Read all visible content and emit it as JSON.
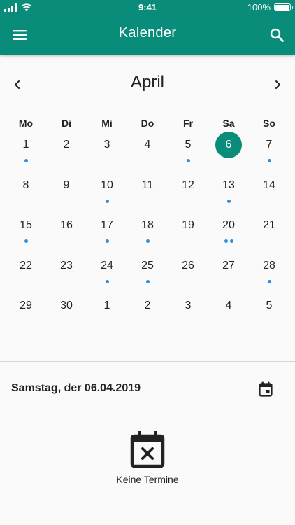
{
  "status_bar": {
    "time": "9:41",
    "battery_text": "100%",
    "battery_level": 1.0,
    "signal_icon": "signal-icon",
    "wifi_icon": "wifi-icon"
  },
  "app_bar": {
    "title": "Kalender",
    "menu_icon": "menu-icon",
    "search_icon": "search-icon",
    "background": "#0a8c7a"
  },
  "calendar": {
    "month": "April",
    "prev_icon": "chevron-left-icon",
    "next_icon": "chevron-right-icon",
    "weekdays": [
      "Mo",
      "Di",
      "Mi",
      "Do",
      "Fr",
      "Sa",
      "So"
    ],
    "selected_color": "#0a8c7a",
    "event_dot_color": "#2a8fe0",
    "weeks": [
      [
        {
          "day": "1",
          "dots": 1,
          "selected": false
        },
        {
          "day": "2",
          "dots": 0,
          "selected": false
        },
        {
          "day": "3",
          "dots": 0,
          "selected": false
        },
        {
          "day": "4",
          "dots": 0,
          "selected": false
        },
        {
          "day": "5",
          "dots": 1,
          "selected": false
        },
        {
          "day": "6",
          "dots": 0,
          "selected": true
        },
        {
          "day": "7",
          "dots": 1,
          "selected": false
        }
      ],
      [
        {
          "day": "8",
          "dots": 0,
          "selected": false
        },
        {
          "day": "9",
          "dots": 0,
          "selected": false
        },
        {
          "day": "10",
          "dots": 1,
          "selected": false
        },
        {
          "day": "11",
          "dots": 0,
          "selected": false
        },
        {
          "day": "12",
          "dots": 0,
          "selected": false
        },
        {
          "day": "13",
          "dots": 1,
          "selected": false
        },
        {
          "day": "14",
          "dots": 0,
          "selected": false
        }
      ],
      [
        {
          "day": "15",
          "dots": 1,
          "selected": false
        },
        {
          "day": "16",
          "dots": 0,
          "selected": false
        },
        {
          "day": "17",
          "dots": 1,
          "selected": false
        },
        {
          "day": "18",
          "dots": 1,
          "selected": false
        },
        {
          "day": "19",
          "dots": 0,
          "selected": false
        },
        {
          "day": "20",
          "dots": 2,
          "selected": false
        },
        {
          "day": "21",
          "dots": 0,
          "selected": false
        }
      ],
      [
        {
          "day": "22",
          "dots": 0,
          "selected": false
        },
        {
          "day": "23",
          "dots": 0,
          "selected": false
        },
        {
          "day": "24",
          "dots": 1,
          "selected": false
        },
        {
          "day": "25",
          "dots": 1,
          "selected": false
        },
        {
          "day": "26",
          "dots": 0,
          "selected": false
        },
        {
          "day": "27",
          "dots": 0,
          "selected": false
        },
        {
          "day": "28",
          "dots": 1,
          "selected": false
        }
      ],
      [
        {
          "day": "29",
          "dots": 0,
          "selected": false
        },
        {
          "day": "30",
          "dots": 0,
          "selected": false
        },
        {
          "day": "1",
          "dots": 0,
          "selected": false
        },
        {
          "day": "2",
          "dots": 0,
          "selected": false
        },
        {
          "day": "3",
          "dots": 0,
          "selected": false
        },
        {
          "day": "4",
          "dots": 0,
          "selected": false
        },
        {
          "day": "5",
          "dots": 0,
          "selected": false
        }
      ]
    ]
  },
  "selected_date": {
    "label": "Samstag, der 06.04.2019",
    "today_icon": "calendar-today-icon"
  },
  "empty_state": {
    "icon": "calendar-remove-icon",
    "text": "Keine Termine"
  }
}
